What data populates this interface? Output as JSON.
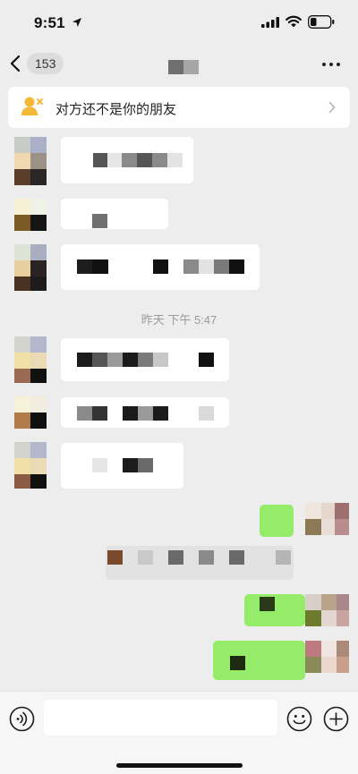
{
  "status_bar": {
    "time": "9:51"
  },
  "nav": {
    "back_badge": "153"
  },
  "notice": {
    "text": "对方还不是你的朋友"
  },
  "chat": {
    "timestamp": "昨天 下午 5:47"
  },
  "colors": {
    "outgoing_bubble": "#95ec69",
    "incoming_bubble": "#ffffff",
    "background": "#ededed",
    "notice_icon": "#f5b93a"
  },
  "icons": {
    "location": "location-arrow-icon",
    "signal": "cellular-signal-icon",
    "wifi": "wifi-icon",
    "battery": "battery-icon",
    "back": "chevron-left-icon",
    "more": "more-dots-icon",
    "notice": "person-x-icon",
    "voice": "voice-icon",
    "emoji": "emoji-icon",
    "plus": "plus-icon"
  }
}
